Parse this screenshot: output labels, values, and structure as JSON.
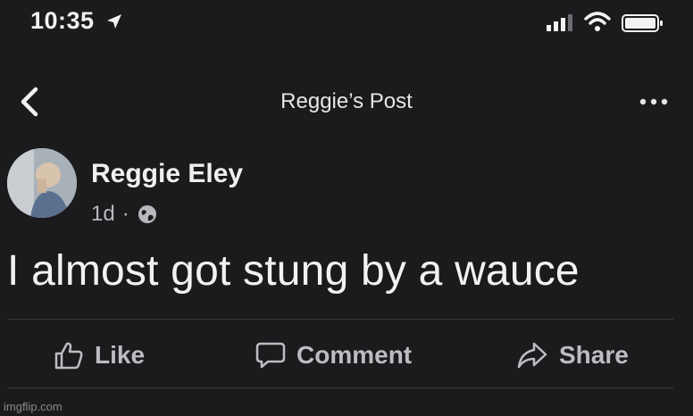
{
  "status_bar": {
    "time": "10:35",
    "icons": [
      "location-arrow-icon",
      "signal-bars-icon",
      "wifi-icon",
      "battery-icon"
    ]
  },
  "nav": {
    "title": "Reggie’s Post",
    "back_icon": "chevron-left-icon",
    "more_icon": "more-dots-icon"
  },
  "post": {
    "author": "Reggie Eley",
    "time_ago": "1d",
    "separator": "·",
    "privacy_icon": "globe-icon",
    "text": "I almost got stung by a wauce"
  },
  "actions": {
    "like": "Like",
    "comment": "Comment",
    "share": "Share"
  },
  "watermark": "imgflip.com",
  "colors": {
    "background": "#1b1b1d",
    "text_primary": "#f2f2f4",
    "text_secondary": "#b9b9bd",
    "divider": "#3a3a3e"
  }
}
